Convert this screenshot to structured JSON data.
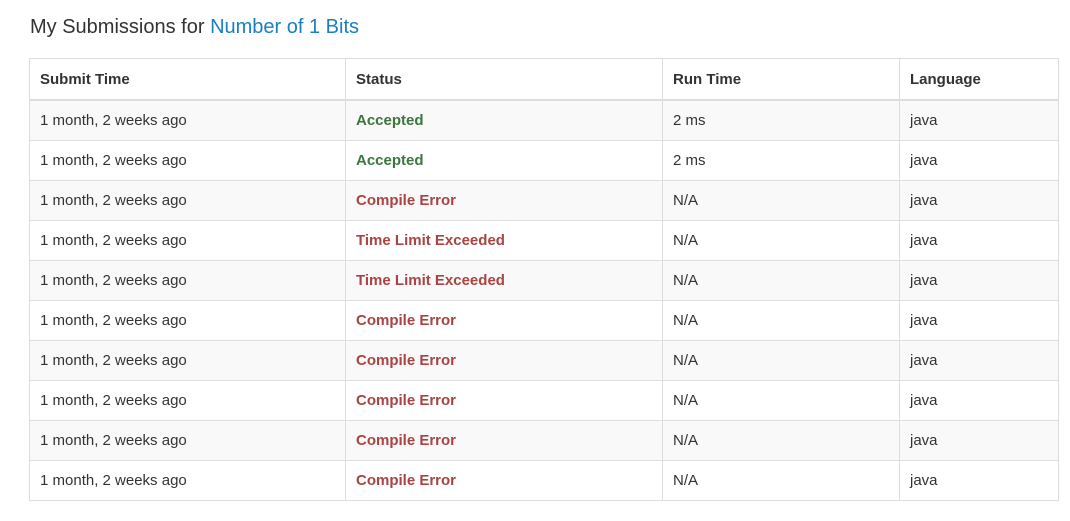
{
  "header": {
    "prefix": "My Submissions for",
    "problem_title": "Number of 1 Bits"
  },
  "table": {
    "columns": [
      "Submit Time",
      "Status",
      "Run Time",
      "Language"
    ],
    "rows": [
      {
        "submit_time": "1 month, 2 weeks ago",
        "status": "Accepted",
        "run_time": "2 ms",
        "language": "java"
      },
      {
        "submit_time": "1 month, 2 weeks ago",
        "status": "Accepted",
        "run_time": "2 ms",
        "language": "java"
      },
      {
        "submit_time": "1 month, 2 weeks ago",
        "status": "Compile Error",
        "run_time": "N/A",
        "language": "java"
      },
      {
        "submit_time": "1 month, 2 weeks ago",
        "status": "Time Limit Exceeded",
        "run_time": "N/A",
        "language": "java"
      },
      {
        "submit_time": "1 month, 2 weeks ago",
        "status": "Time Limit Exceeded",
        "run_time": "N/A",
        "language": "java"
      },
      {
        "submit_time": "1 month, 2 weeks ago",
        "status": "Compile Error",
        "run_time": "N/A",
        "language": "java"
      },
      {
        "submit_time": "1 month, 2 weeks ago",
        "status": "Compile Error",
        "run_time": "N/A",
        "language": "java"
      },
      {
        "submit_time": "1 month, 2 weeks ago",
        "status": "Compile Error",
        "run_time": "N/A",
        "language": "java"
      },
      {
        "submit_time": "1 month, 2 weeks ago",
        "status": "Compile Error",
        "run_time": "N/A",
        "language": "java"
      },
      {
        "submit_time": "1 month, 2 weeks ago",
        "status": "Compile Error",
        "run_time": "N/A",
        "language": "java"
      }
    ]
  },
  "colors": {
    "accepted": "#3c763d",
    "error": "#a94442",
    "link": "#1a7fc1",
    "stripe": "#f9f9f9",
    "border": "#dddddd"
  }
}
